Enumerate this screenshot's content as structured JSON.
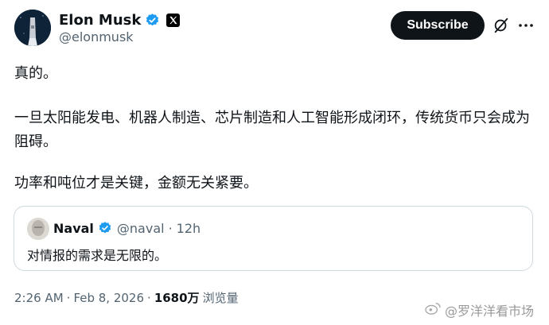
{
  "author": {
    "name": "Elon Musk",
    "handle": "@elonmusk"
  },
  "actions": {
    "subscribe_label": "Subscribe"
  },
  "tweet": {
    "paragraphs": [
      "真的。",
      "一旦太阳能发电、机器人制造、芯片制造和人工智能形成闭环，传统货币只会成为阻碍。",
      "功率和吨位才是关键，金额无关紧要。"
    ]
  },
  "quoted_tweet": {
    "name": "Naval",
    "handle": "@naval",
    "separator": "·",
    "age": "12h",
    "text": "对情报的需求是无限的。"
  },
  "meta": {
    "time": "2:26 AM",
    "separator": "·",
    "date": "Feb 8, 2026",
    "views_count": "1680万",
    "views_label": "浏览量"
  },
  "watermark": {
    "text": "@罗洋洋看市场"
  },
  "colors": {
    "verified": "#1d9bf0",
    "secondary_text": "#536471",
    "primary_text": "#0f1419"
  }
}
